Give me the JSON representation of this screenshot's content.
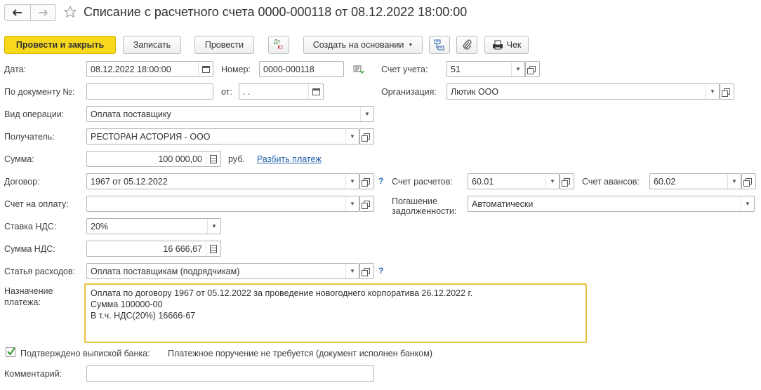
{
  "header": {
    "title": "Списание с расчетного счета 0000-000118 от 08.12.2022 18:00:00"
  },
  "toolbar": {
    "post_close": "Провести и закрыть",
    "save": "Записать",
    "post": "Провести",
    "dtkt_top": "Дт",
    "dtkt_bottom": "Кт",
    "create_based": "Создать на основании",
    "receipt": "Чек"
  },
  "form": {
    "date_label": "Дата:",
    "date_value": "08.12.2022 18:00:00",
    "number_label": "Номер:",
    "number_value": "0000-000118",
    "account_label": "Счет учета:",
    "account_value": "51",
    "bydoc_label": "По документу №:",
    "bydoc_value": "",
    "from_label": "от:",
    "from_value": " .  .",
    "org_label": "Организация:",
    "org_value": "Лютик ООО",
    "optype_label": "Вид операции:",
    "optype_value": "Оплата поставщику",
    "recipient_label": "Получатель:",
    "recipient_value": "РЕСТОРАН АСТОРИЯ - ООО",
    "sum_label": "Сумма:",
    "sum_value": "100 000,00",
    "currency": "руб.",
    "split_link": "Разбить платеж",
    "contract_label": "Договор:",
    "contract_value": "1967 от 05.12.2022",
    "q_mark": "?",
    "settle_label": "Счет расчетов:",
    "settle_value": "60.01",
    "advance_label": "Счет авансов:",
    "advance_value": "60.02",
    "invoice_label": "Счет на оплату:",
    "invoice_value": "",
    "repay_label_1": "Погашение",
    "repay_label_2": "задолженности:",
    "repay_value": "Автоматически",
    "vat_rate_label": "Ставка НДС:",
    "vat_rate_value": "20%",
    "vat_sum_label": "Сумма НДС:",
    "vat_sum_value": "16 666,67",
    "expense_label": "Статья расходов:",
    "expense_value": "Оплата поставщикам (подрядчикам)",
    "purpose_label_1": "Назначение",
    "purpose_label_2": "платежа:",
    "purpose_line1": "Оплата по договору 1967 от 05.12.2022 за проведение новогоднего корпоратива 26.12.2022 г.",
    "purpose_line2": "Сумма 100000-00",
    "purpose_line3": "В т.ч. НДС(20%) 16666-67",
    "confirmed_label": "Подтверждено выпиской банка:",
    "confirmed_checked": true,
    "order_note": "Платежное поручение не требуется (документ исполнен банком)",
    "comment_label": "Комментарий:",
    "comment_value": ""
  },
  "colors": {
    "primary_button": "#f7d81d",
    "link": "#1f5fa8",
    "help": "#2b6bb5",
    "focus_border": "#e8c13a",
    "check": "#3a9a3a"
  },
  "icons": [
    "back-arrow-icon",
    "forward-arrow-icon",
    "star-icon",
    "structure-icon",
    "paperclip-icon",
    "receipt-printer-icon",
    "calendar-icon",
    "calculator-icon",
    "open-icon",
    "dropdown-arrow-icon",
    "check-icon",
    "copy-number-icon"
  ]
}
